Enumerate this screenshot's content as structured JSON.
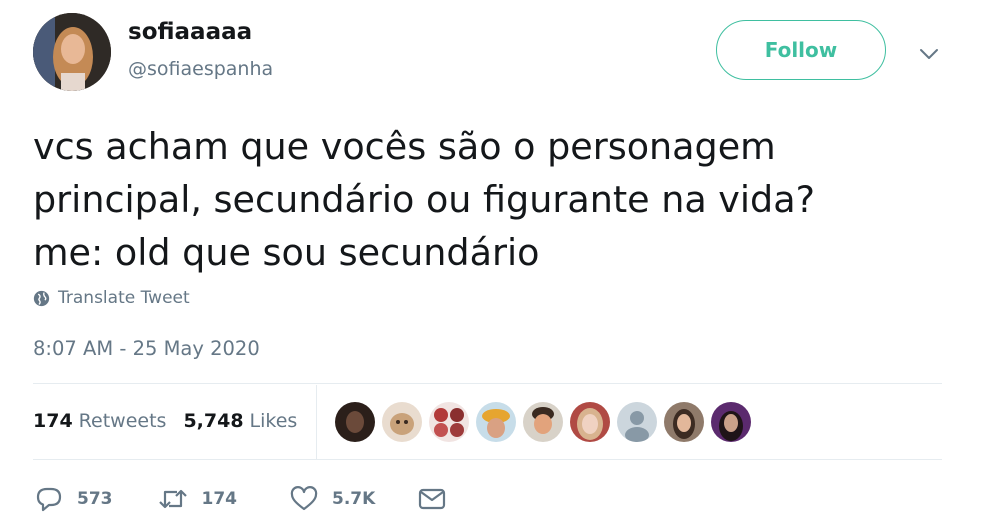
{
  "user": {
    "display_name": "sofiaaaaa",
    "handle": "@sofiaespanha",
    "avatar_icon": "profile-photo"
  },
  "follow_label": "Follow",
  "accent_color": "#3fbfa0",
  "tweet": {
    "lines": [
      "vcs acham que vocês são o personagem",
      "principal, secundário ou figurante na vida?",
      "me: old que sou secundário"
    ]
  },
  "translate_label": "Translate Tweet",
  "timestamp": "8:07 AM - 25 May 2020",
  "stats": {
    "retweets_count": "174",
    "retweets_label": "Retweets",
    "likes_count": "5,748",
    "likes_label": "Likes"
  },
  "liked_by_avatar_count": 9,
  "actions": {
    "replies": "573",
    "retweets": "174",
    "likes": "5.7K"
  }
}
